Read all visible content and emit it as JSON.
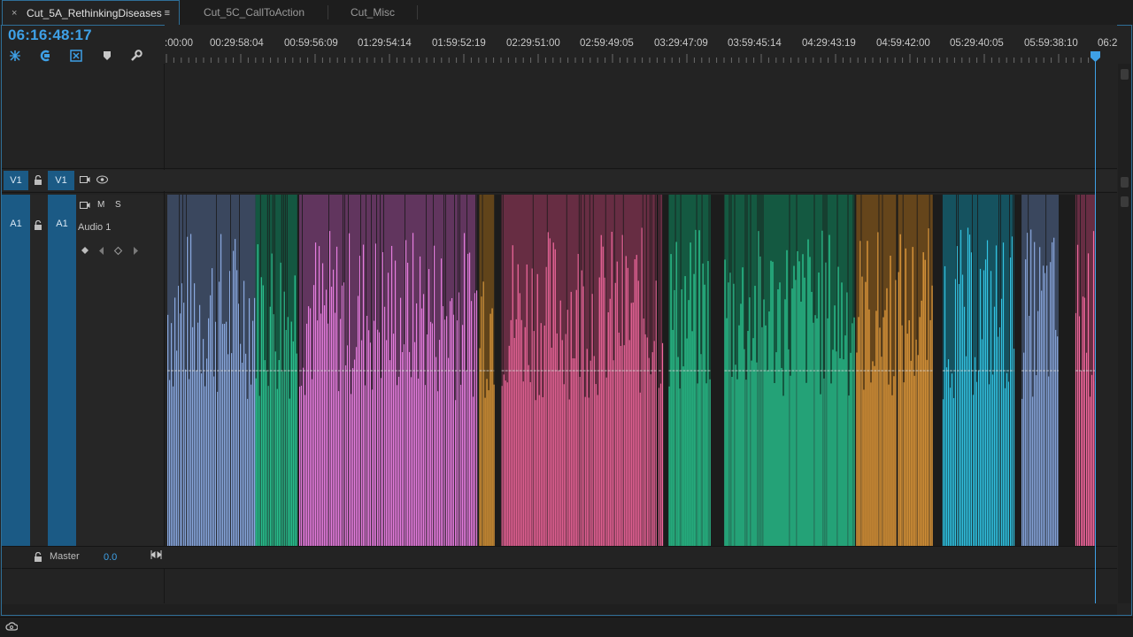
{
  "tabs": [
    {
      "label": "Cut_5A_RethinkingDiseases",
      "active": true
    },
    {
      "label": "Cut_5C_CallToAction",
      "active": false
    },
    {
      "label": "Cut_Misc",
      "active": false
    }
  ],
  "icons": {
    "tab_close": "×",
    "tab_menu": "≡",
    "lock": "lock-icon",
    "camera": "video-track-icon",
    "eye": "eye-icon",
    "wrench": "wrench-icon"
  },
  "timecode": "06:16:48:17",
  "ruler_labels": [
    ":00:00",
    "00:29:58:04",
    "00:59:56:09",
    "01:29:54:14",
    "01:59:52:19",
    "02:29:51:00",
    "02:59:49:05",
    "03:29:47:09",
    "03:59:45:14",
    "04:29:43:19",
    "04:59:42:00",
    "05:29:40:05",
    "05:59:38:10",
    "06:2"
  ],
  "video_track": {
    "source_label": "V1",
    "target_label": "V1"
  },
  "audio_track": {
    "source_label": "A1",
    "target_label": "A1",
    "name": "Audio 1",
    "mute_label": "M",
    "solo_label": "S"
  },
  "master": {
    "label": "Master",
    "value": "0.0"
  },
  "colors": {
    "accent": "#3ea0e6",
    "track_target": "#1b5a85",
    "clip_colors": [
      "#8aa9e0",
      "#2fcf9a",
      "#e77ee0",
      "#e8a23e",
      "#f56aa0",
      "#2fd39b",
      "#f0a540",
      "#33c4e3",
      "#8aa9e0",
      "#f56aa0"
    ]
  },
  "audio_clips": [
    {
      "color": "#8aa9e0",
      "start": 0.0,
      "end": 0.095
    },
    {
      "color": "#2fcf9a",
      "start": 0.095,
      "end": 0.14
    },
    {
      "color": "#e77ee0",
      "start": 0.142,
      "end": 0.333
    },
    {
      "color": "#e8a23e",
      "start": 0.336,
      "end": 0.352
    },
    {
      "color": "#f56aa0",
      "start": 0.36,
      "end": 0.527
    },
    {
      "color": "#f56aa0",
      "start": 0.529,
      "end": 0.533
    },
    {
      "color": "#2fd39b",
      "start": 0.54,
      "end": 0.585
    },
    {
      "color": "#2fd39b",
      "start": 0.6,
      "end": 0.74
    },
    {
      "color": "#f0a540",
      "start": 0.742,
      "end": 0.785
    },
    {
      "color": "#f0a540",
      "start": 0.787,
      "end": 0.825
    },
    {
      "color": "#33c4e3",
      "start": 0.835,
      "end": 0.912
    },
    {
      "color": "#8aa9e0",
      "start": 0.92,
      "end": 0.96
    },
    {
      "color": "#f56aa0",
      "start": 0.978,
      "end": 1.0
    }
  ]
}
